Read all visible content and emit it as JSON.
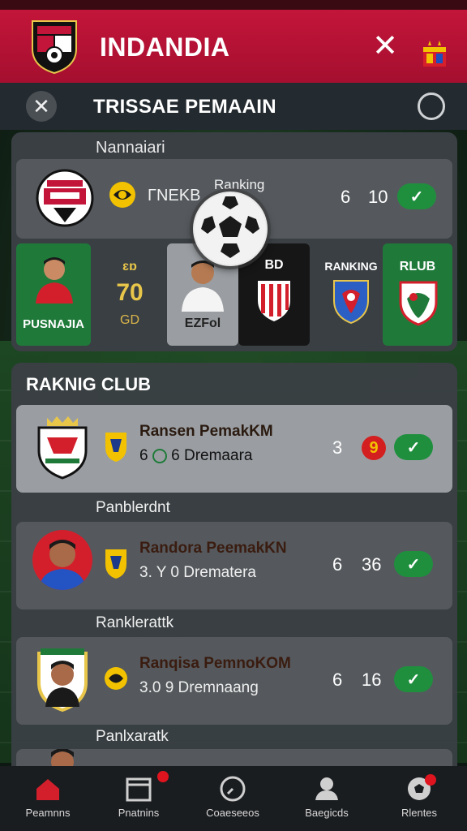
{
  "header": {
    "title": "INDANDIA",
    "close_icon": "close-icon",
    "flag_icon": "flag-icon",
    "bar_color": "#c3153a"
  },
  "subheader": {
    "title": "TRISSAE PEMAAIN",
    "back_icon": "close-icon",
    "menu_icon": "circle-icon"
  },
  "featured": {
    "label": "Nannaiari",
    "row": {
      "name": "ΓNEKB",
      "caption": "Ranking",
      "value_a": "6",
      "value_b": "10"
    },
    "tiles": {
      "player1_caption": "PUSNAJIA",
      "gold_top": "ɛɒ",
      "gold_value": "70",
      "gold_bottom": "GD",
      "player2_caption": "EZFol",
      "dark_label": "BD",
      "slate_label": "RANKING",
      "green_label": "RLUB"
    }
  },
  "ranking": {
    "title": "RAKNIG CLUB",
    "rows": [
      {
        "name": "Ransen PemakKM",
        "sub_left": "6",
        "sub_mid": "6 Dremaara",
        "n1": "3",
        "badge": "9"
      },
      {
        "name": "Randora PeemakKN",
        "sub": "3. Y 0  Drematera",
        "n1": "6",
        "n2": "36"
      },
      {
        "name": "Ranqisa PemnoKOM",
        "sub": "3.0 9  Dremnaang",
        "n1": "6",
        "n2": "16"
      }
    ],
    "group_labels": [
      "Panblerdnt",
      "Ranklerattk",
      "Panlxaratk"
    ]
  },
  "bottom_nav": [
    {
      "label": "Peamnns",
      "icon": "home-icon"
    },
    {
      "label": "Pnatnins",
      "icon": "calendar-icon"
    },
    {
      "label": "Coaeseeos",
      "icon": "clock-icon"
    },
    {
      "label": "Baegicds",
      "icon": "user-icon"
    },
    {
      "label": "Rlentes",
      "icon": "ball-icon"
    }
  ]
}
